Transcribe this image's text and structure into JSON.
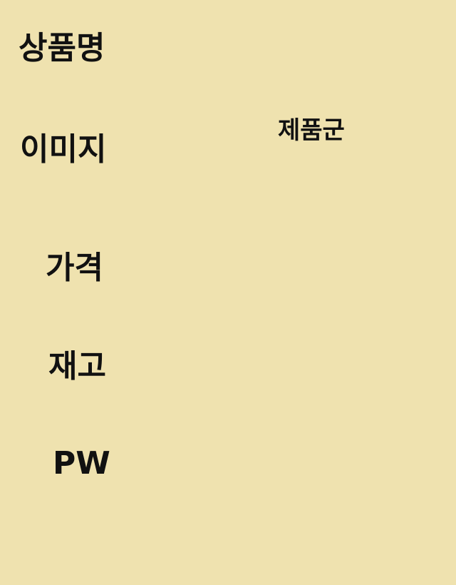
{
  "form": {
    "product_name_label": "상품명",
    "image_label": "이미지",
    "price_label": "가격",
    "stock_label": "재고",
    "pw_label": "PW",
    "category_label": "제품군"
  },
  "colors": {
    "background": "#EFE2AF",
    "text": "#111111"
  }
}
